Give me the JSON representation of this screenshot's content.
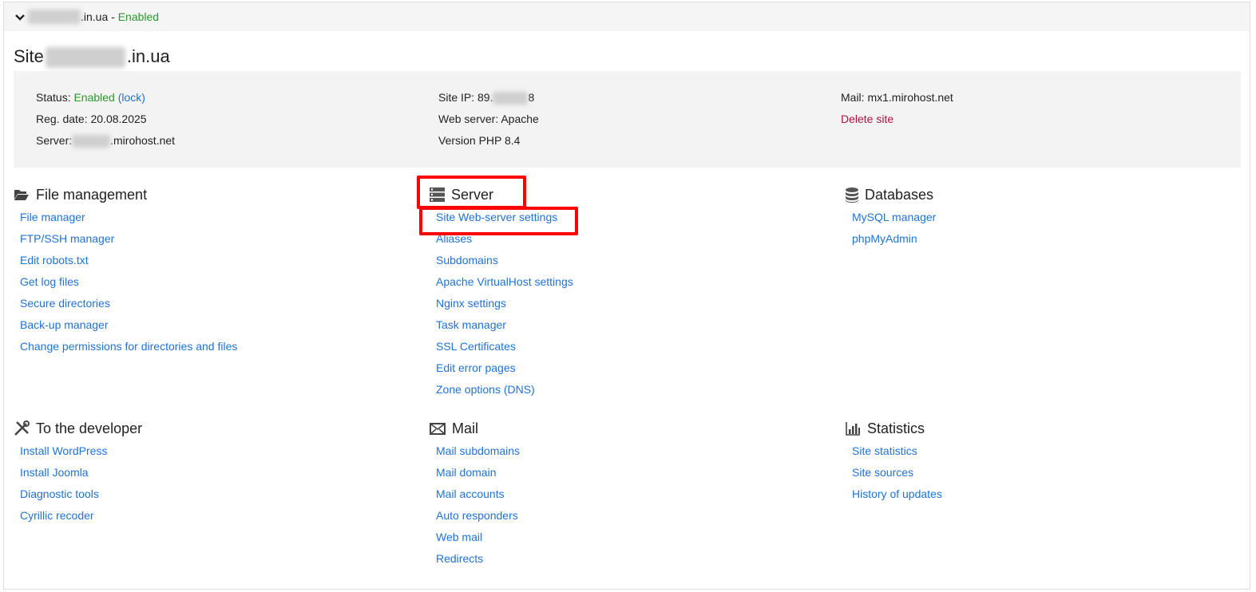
{
  "header": {
    "domain_suffix": ".in.ua",
    "separator": " - ",
    "status": "Enabled"
  },
  "title": {
    "prefix": "Site",
    "suffix": ".in.ua"
  },
  "info": {
    "status_label": "Status: ",
    "status_value": "Enabled",
    "lock_link": "(lock)",
    "reg_date": "Reg. date: 20.08.2025",
    "server_label": "Server:",
    "server_suffix": ".mirohost.net",
    "site_ip_label": "Site IP: 89.",
    "site_ip_suffix": "8",
    "web_server": "Web server: Apache",
    "php_version": "Version PHP 8.4",
    "mail": "Mail: mx1.mirohost.net",
    "delete_site": "Delete site"
  },
  "sections": {
    "file": {
      "title": "File management",
      "items": [
        "File manager",
        "FTP/SSH manager",
        "Edit robots.txt",
        "Get log files",
        "Secure directories",
        "Back-up manager",
        "Change permissions for directories and files"
      ]
    },
    "server": {
      "title": "Server",
      "items": [
        "Site Web-server settings",
        "Aliases",
        "Subdomains",
        "Apache VirtualHost settings",
        "Nginx settings",
        "Task manager",
        "SSL Certificates",
        "Edit error pages",
        "Zone options (DNS)"
      ]
    },
    "db": {
      "title": "Databases",
      "items": [
        "MySQL manager",
        "phpMyAdmin"
      ]
    },
    "dev": {
      "title": "To the developer",
      "items": [
        "Install WordPress",
        "Install Joomla",
        "Diagnostic tools",
        "Cyrillic recoder"
      ]
    },
    "mail": {
      "title": "Mail",
      "items": [
        "Mail subdomains",
        "Mail domain",
        "Mail accounts",
        "Auto responders",
        "Web mail",
        "Redirects"
      ]
    },
    "stats": {
      "title": "Statistics",
      "items": [
        "Site statistics",
        "Site sources",
        "History of updates"
      ]
    }
  }
}
